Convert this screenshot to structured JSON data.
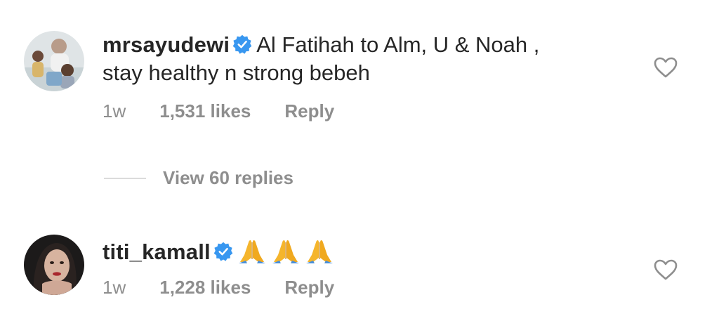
{
  "comments": [
    {
      "username": "mrsayudewi",
      "verified": true,
      "text_line1": "Al Fatihah to Alm, U & Noah ,",
      "text_line2": "stay healthy n strong bebeh",
      "time": "1w",
      "likes": "1,531 likes",
      "reply_label": "Reply",
      "view_replies_label": "View 60 replies"
    },
    {
      "username": "titi_kamall",
      "verified": true,
      "emojis": [
        "folded-hands",
        "folded-hands",
        "folded-hands"
      ],
      "time": "1w",
      "likes": "1,228 likes",
      "reply_label": "Reply"
    }
  ],
  "colors": {
    "text": "#262626",
    "muted": "#8e8e8e",
    "verified_blue": "#3897f0",
    "divider": "#dbdbdb"
  },
  "icons": [
    "verified-badge-icon",
    "heart-outline-icon",
    "folded-hands-emoji"
  ]
}
